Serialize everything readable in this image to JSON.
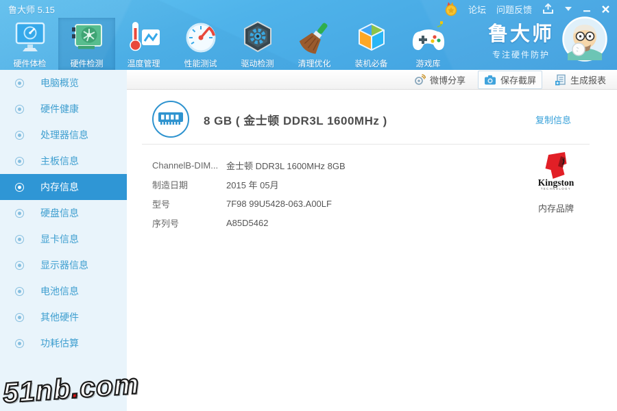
{
  "titlebar": {
    "title": "鲁大师 5.15",
    "forum_link": "论坛",
    "feedback_link": "问题反馈"
  },
  "toolbar": {
    "items": [
      {
        "label": "硬件体检",
        "selected": false
      },
      {
        "label": "硬件检测",
        "selected": true
      },
      {
        "label": "温度管理",
        "selected": false
      },
      {
        "label": "性能测试",
        "selected": false
      },
      {
        "label": "驱动检测",
        "selected": false
      },
      {
        "label": "清理优化",
        "selected": false
      },
      {
        "label": "装机必备",
        "selected": false
      },
      {
        "label": "游戏库",
        "selected": false
      }
    ]
  },
  "brand": {
    "name": "鲁大师",
    "slogan": "专注硬件防护"
  },
  "actionbar": {
    "weibo_share": "微博分享",
    "save_screenshot": "保存截屏",
    "generate_report": "生成报表"
  },
  "sidebar": {
    "items": [
      {
        "label": "电脑概览",
        "selected": false
      },
      {
        "label": "硬件健康",
        "selected": false
      },
      {
        "label": "处理器信息",
        "selected": false
      },
      {
        "label": "主板信息",
        "selected": false
      },
      {
        "label": "内存信息",
        "selected": true
      },
      {
        "label": "硬盘信息",
        "selected": false
      },
      {
        "label": "显卡信息",
        "selected": false
      },
      {
        "label": "显示器信息",
        "selected": false
      },
      {
        "label": "电池信息",
        "selected": false
      },
      {
        "label": "其他硬件",
        "selected": false
      },
      {
        "label": "功耗估算",
        "selected": false
      }
    ]
  },
  "main": {
    "summary": "8 GB ( 金士顿 DDR3L 1600MHz )",
    "copy_link": "复制信息",
    "rows": [
      {
        "label": "ChannelB-DIM...",
        "value": "金士顿 DDR3L 1600MHz 8GB"
      },
      {
        "label": "制造日期",
        "value": "2015 年 05月"
      },
      {
        "label": "型号",
        "value": "7F98 99U5428-063.A00LF"
      },
      {
        "label": "序列号",
        "value": "A85D5462"
      }
    ],
    "brand_logo_text": "Kingston",
    "brand_logo_sub": "TECHNOLOGY",
    "brand_caption": "内存品牌"
  },
  "watermark": {
    "part1": "51nb",
    "dot": ".",
    "part2": "com"
  },
  "colors": {
    "accent_blue": "#2f96d5",
    "sidebar_bg": "#e9f4fb",
    "sidebar_text": "#3f9fd0",
    "link_blue": "#36a0d9",
    "topbar_gradient_top": "#63c4f2",
    "topbar_gradient_bottom": "#3f9ede",
    "kingston_red": "#e21f26"
  }
}
